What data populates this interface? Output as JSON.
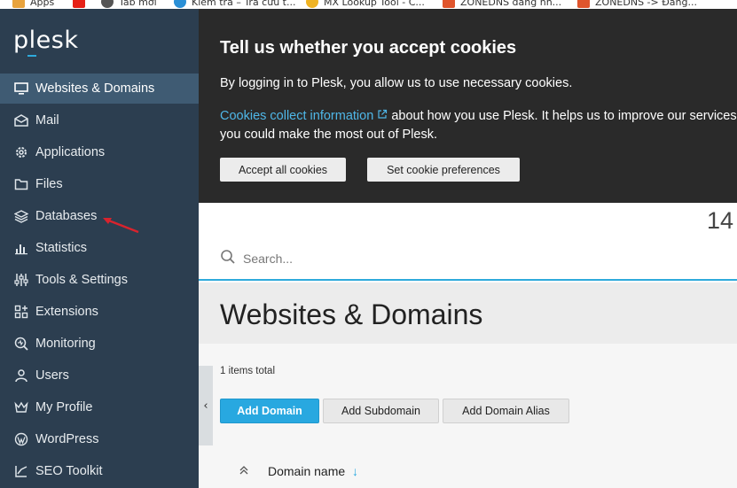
{
  "bookmarks": [
    {
      "label": "Apps",
      "color": "#e8a33d"
    },
    {
      "label": "",
      "color": "#e62117"
    },
    {
      "label": "Tab mới",
      "color": "#555555"
    },
    {
      "label": "Kiểm tra – Tra cứu t...",
      "color": "#2a8fd6"
    },
    {
      "label": "MX Lookup Tool - C...",
      "color": "#f0b323"
    },
    {
      "label": "ZONEDNS đăng nh...",
      "color": "#e0552c"
    },
    {
      "label": "ZONEDNS -> Đăng...",
      "color": "#e0552c"
    }
  ],
  "sidebar": {
    "logo": "plesk",
    "items": [
      {
        "label": "Websites & Domains",
        "icon": "monitor-icon",
        "active": true
      },
      {
        "label": "Mail",
        "icon": "mail-icon"
      },
      {
        "label": "Applications",
        "icon": "gear-icon"
      },
      {
        "label": "Files",
        "icon": "folder-icon"
      },
      {
        "label": "Databases",
        "icon": "layers-icon"
      },
      {
        "label": "Statistics",
        "icon": "bar-chart-icon"
      },
      {
        "label": "Tools & Settings",
        "icon": "sliders-icon"
      },
      {
        "label": "Extensions",
        "icon": "extensions-icon"
      },
      {
        "label": "Monitoring",
        "icon": "monitoring-icon"
      },
      {
        "label": "Users",
        "icon": "user-icon"
      },
      {
        "label": "My Profile",
        "icon": "crown-icon"
      },
      {
        "label": "WordPress",
        "icon": "wordpress-icon"
      },
      {
        "label": "SEO Toolkit",
        "icon": "seo-icon"
      }
    ]
  },
  "cookie_banner": {
    "title": "Tell us whether you accept cookies",
    "line1": "By logging in to Plesk, you allow us to use necessary cookies.",
    "link_text": "Cookies collect information",
    "line2_rest": " about how you use Plesk. It helps us to improve our services so that you could make the most out of Plesk.",
    "accept_label": "Accept all cookies",
    "prefs_label": "Set cookie preferences"
  },
  "main": {
    "page_number": "14",
    "search_placeholder": "Search...",
    "page_title": "Websites & Domains",
    "items_total": "1 items total",
    "buttons": {
      "add_domain": "Add Domain",
      "add_subdomain": "Add Subdomain",
      "add_domain_alias": "Add Domain Alias"
    },
    "columns": {
      "domain_name": "Domain name"
    }
  },
  "colors": {
    "sidebar_bg": "#2c3e50",
    "sidebar_active": "#3f5b73",
    "accent": "#28a8e0",
    "cookie_bg": "#2a2a2a",
    "annotation_arrow": "#d9232d"
  }
}
